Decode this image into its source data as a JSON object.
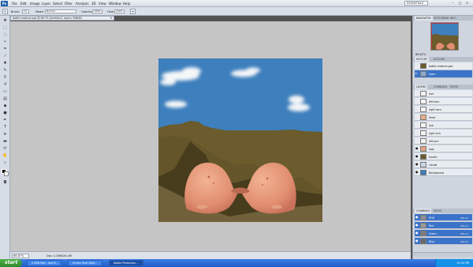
{
  "menubar": {
    "logo": "Ps",
    "items": [
      "File",
      "Edit",
      "Image",
      "Layer",
      "Select",
      "Filter",
      "Analysis",
      "3D",
      "View",
      "Window",
      "Help"
    ],
    "workspace": "ESSENTIALS",
    "window_controls": [
      "–",
      "□",
      "×"
    ]
  },
  "options": {
    "brush_label": "Brush:",
    "brush_size": "13",
    "mode_label": "Mode:",
    "mode_value": "Normal",
    "opacity_label": "Opacity:",
    "opacity_value": "100%",
    "flow_label": "Flow:",
    "flow_value": "100%"
  },
  "document": {
    "tab_title": "battle creature.psd @ 66.7% (Untitled-1 layers, RGB/8)",
    "close": "×",
    "zoom": "66.67%",
    "doc_size": "Doc: 2.46M/26.4M"
  },
  "navigator": {
    "tabs": [
      "NAVIGATOR",
      "HISTOGRAM",
      "INFO"
    ],
    "zoom": "66.67%"
  },
  "history": {
    "tabs": [
      "HISTORY",
      "ACTIONS"
    ],
    "items": [
      {
        "label": "battle creature.psd",
        "selected": false
      },
      {
        "label": "Open",
        "selected": true
      }
    ]
  },
  "layers": {
    "tabs": [
      "LAYERS",
      "CHANNELS",
      "PATHS"
    ],
    "items": [
      {
        "label": "hair",
        "thumb": "#f3f3f3",
        "visible": false,
        "selected": false
      },
      {
        "label": "left horn",
        "thumb": "#f3f3f3",
        "visible": false,
        "selected": false
      },
      {
        "label": "right horn",
        "thumb": "#f3f3f3",
        "visible": false,
        "selected": false
      },
      {
        "label": "head",
        "thumb": "#e7b08c",
        "visible": false,
        "selected": false
      },
      {
        "label": "eye",
        "thumb": "#f3f3f3",
        "visible": false,
        "selected": false
      },
      {
        "label": "right arm",
        "thumb": "#f3f3f3",
        "visible": false,
        "selected": false
      },
      {
        "label": "left arm",
        "thumb": "#f3f3f3",
        "visible": false,
        "selected": false
      },
      {
        "label": "legs",
        "thumb": "#e4a07f",
        "visible": true,
        "selected": false
      },
      {
        "label": "hearth",
        "thumb": "#6b5b2d",
        "visible": true,
        "selected": false
      },
      {
        "label": "clouds",
        "thumb": "#c8d8e8",
        "visible": true,
        "selected": false
      },
      {
        "label": "Background",
        "thumb": "#3e7fbd",
        "visible": true,
        "selected": false
      }
    ]
  },
  "channels": {
    "tabs": [
      "CHANNELS",
      "PATHS"
    ],
    "items": [
      {
        "label": "RGB",
        "shortcut": "Ctrl+2",
        "selected": true
      },
      {
        "label": "Red",
        "shortcut": "Ctrl+3",
        "selected": true
      },
      {
        "label": "Green",
        "shortcut": "Ctrl+4",
        "selected": true
      },
      {
        "label": "Blue",
        "shortcut": "Ctrl+5",
        "selected": true
      }
    ]
  },
  "taskbar": {
    "start": "start",
    "buttons": [
      "2 MSN Mail - Jack B...",
      "Screen Shot (Sele...",
      "Adobe Photoshop ..."
    ],
    "clock": "10:34 PM"
  },
  "colors": {
    "sky": "#3e7fbd",
    "ground": "#6b5b2d",
    "skin": "#e7a07f",
    "canvas_bg": "#c5c5c5",
    "selection": "#3b73c8"
  }
}
